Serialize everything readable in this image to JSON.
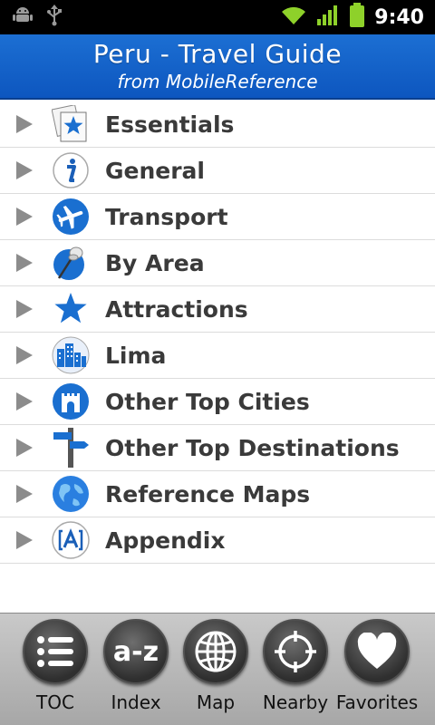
{
  "status_bar": {
    "time": "9:40",
    "icons": [
      "android-debug-icon",
      "usb-icon",
      "wifi-icon",
      "signal-icon",
      "battery-icon"
    ]
  },
  "header": {
    "title": "Peru - Travel Guide",
    "subtitle": "from MobileReference"
  },
  "menu": {
    "items": [
      {
        "label": "Essentials",
        "icon": "essentials-star-card-icon"
      },
      {
        "label": "General",
        "icon": "info-icon"
      },
      {
        "label": "Transport",
        "icon": "airplane-icon"
      },
      {
        "label": "By Area",
        "icon": "pushpin-icon"
      },
      {
        "label": "Attractions",
        "icon": "star-icon"
      },
      {
        "label": "Lima",
        "icon": "city-buildings-icon"
      },
      {
        "label": "Other Top Cities",
        "icon": "castle-tower-icon"
      },
      {
        "label": "Other Top Destinations",
        "icon": "signpost-icon"
      },
      {
        "label": "Reference Maps",
        "icon": "globe-icon"
      },
      {
        "label": "Appendix",
        "icon": "appendix-bracket-a-icon"
      }
    ]
  },
  "toolbar": {
    "buttons": [
      {
        "label": "TOC",
        "icon": "list-icon",
        "glyph": ""
      },
      {
        "label": "Index",
        "icon": "az-index-icon",
        "glyph": "a-z"
      },
      {
        "label": "Map",
        "icon": "globe-grid-icon",
        "glyph": ""
      },
      {
        "label": "Nearby",
        "icon": "crosshair-icon",
        "glyph": ""
      },
      {
        "label": "Favorites",
        "icon": "heart-icon",
        "glyph": ""
      }
    ]
  },
  "colors": {
    "title_bar": "#1565c8",
    "icon_blue": "#1a6fd0",
    "status_green": "#8ed12a"
  }
}
